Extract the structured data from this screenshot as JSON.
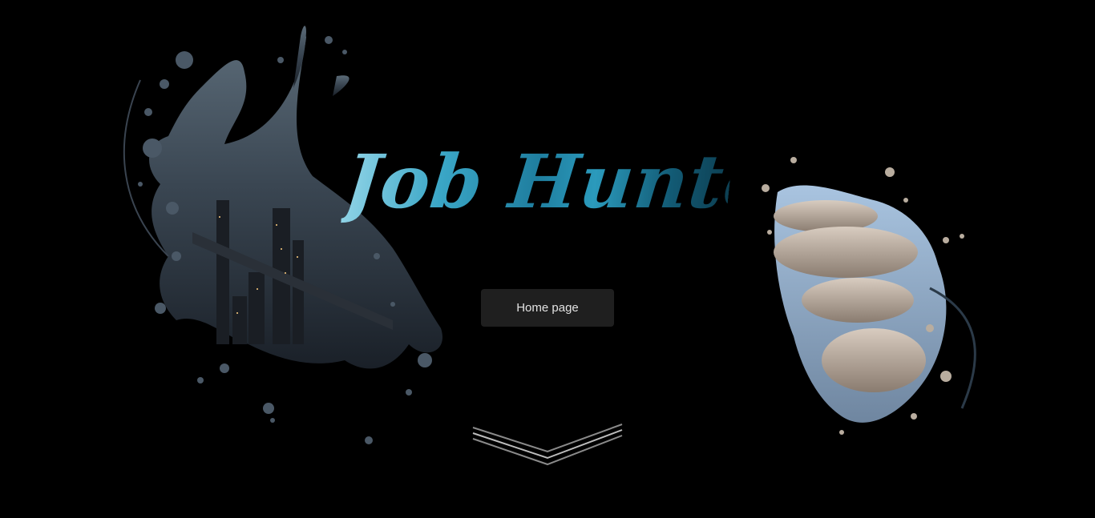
{
  "logo": {
    "text": "Job Hunter",
    "colors": [
      "#8fd3e6",
      "#2a8fb0",
      "#0d3f52"
    ]
  },
  "hero": {
    "home_button_label": "Home page",
    "scroll_icon": "chevron-down-triple-icon"
  },
  "decor": {
    "left_splash_image": "city-skyline-bridge-night",
    "right_splash_image": "stacked-stones-beach",
    "background_color": "#000000",
    "splash_tint_left": "#4a5a68",
    "splash_tint_right": "#b8a898"
  }
}
